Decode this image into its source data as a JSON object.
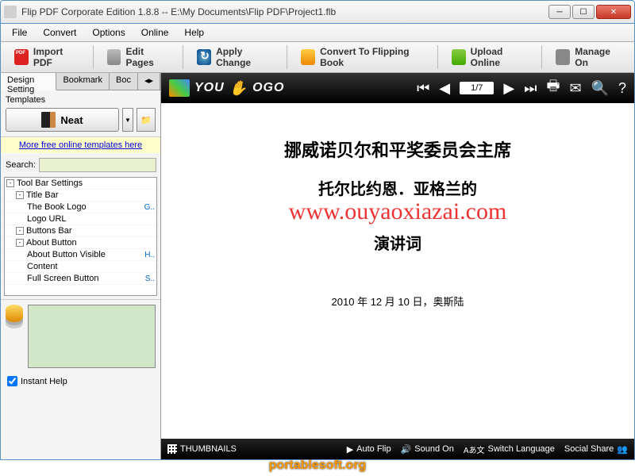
{
  "window": {
    "title": "Flip PDF Corporate Edition 1.8.8  --  E:\\My Documents\\Flip PDF\\Project1.flb"
  },
  "menu": {
    "file": "File",
    "convert": "Convert",
    "options": "Options",
    "online": "Online",
    "help": "Help"
  },
  "toolbar": {
    "import": "Import PDF",
    "edit": "Edit Pages",
    "apply": "Apply Change",
    "conv": "Convert To Flipping Book",
    "upload": "Upload Online",
    "manage": "Manage On"
  },
  "tabs": {
    "design": "Design Setting",
    "bookmark": "Bookmark",
    "boc": "Boc"
  },
  "templates": {
    "label": "Templates",
    "neat": "Neat",
    "link": "More free online templates here"
  },
  "search": {
    "label": "Search:"
  },
  "tree": {
    "root": "Tool Bar Settings",
    "titlebar": "Title Bar",
    "booklogo": "The Book Logo",
    "booklogo_v": "G..",
    "logourl": "Logo URL",
    "buttonsbar": "Buttons Bar",
    "aboutbtn": "About Button",
    "aboutvis": "About Button Visible",
    "aboutvis_v": "H..",
    "content": "Content",
    "fullscreen": "Full Screen Button",
    "fullscreen_v": "S.."
  },
  "instanthelp": "Instant Help",
  "preview": {
    "logo_a": "YOU",
    "logo_b": "OGO",
    "page": "1/7",
    "h1": "挪威诺贝尔和平奖委员会主席",
    "h2": "托尔比约恩．亚格兰的",
    "h3": "演讲词",
    "date": "2010 年 12 月 10 日，奥斯陆",
    "wm": "www.ouyaoxiazai.com"
  },
  "footer": {
    "thumbs": "THUMBNAILS",
    "autoflip": "Auto Flip",
    "sound": "Sound On",
    "lang": "Switch Language",
    "langic": "Aあ文",
    "share": "Social Share"
  },
  "wm2": "portablesoft.org"
}
